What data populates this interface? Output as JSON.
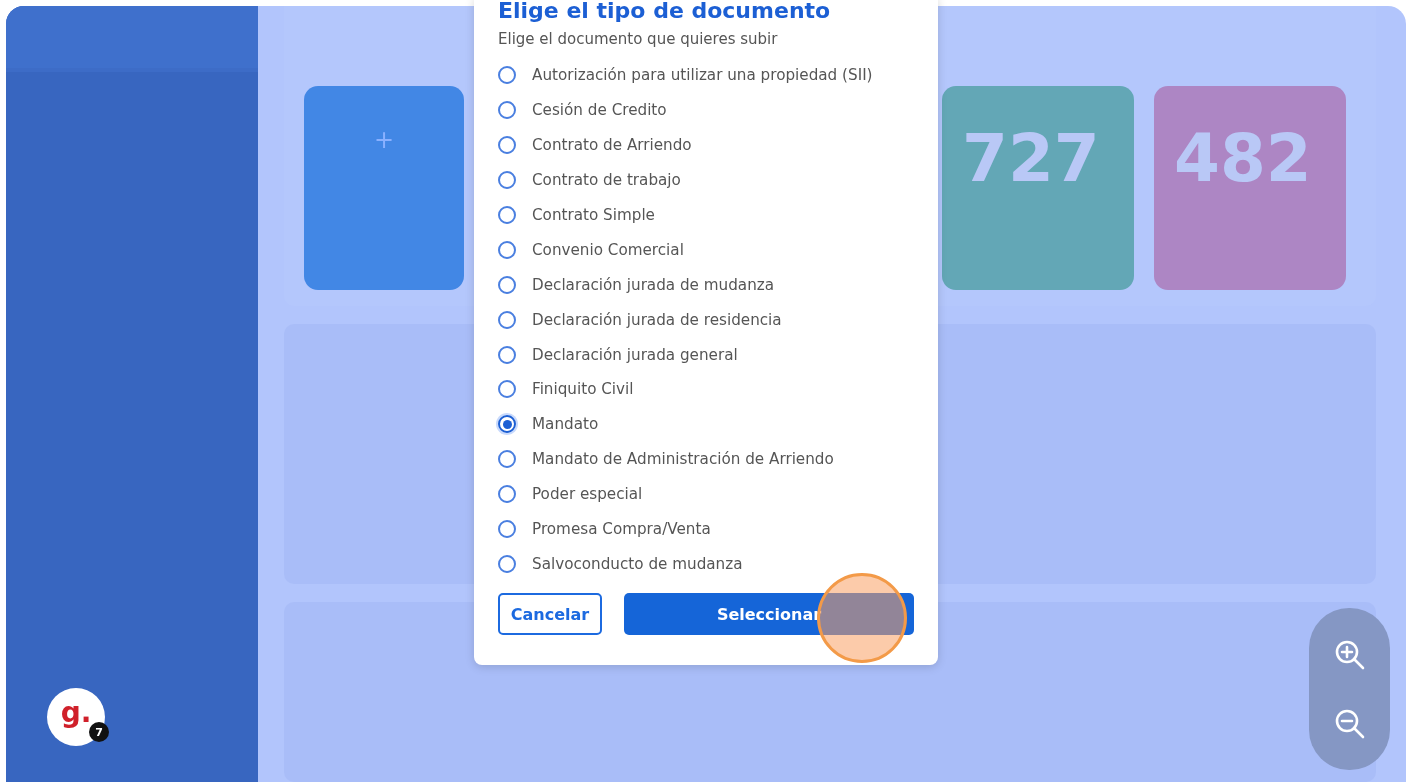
{
  "background": {
    "create_card": {
      "symbol": "+"
    },
    "stats": [
      {
        "value": "727",
        "color": "#63a7b6"
      },
      {
        "value": "482",
        "color": "#ad86c4"
      }
    ]
  },
  "dialog": {
    "title": "Elige el tipo de documento",
    "subtitle": "Elige el documento que quieres subir",
    "options": [
      {
        "label": "Autorización para utilizar una propiedad (SII)",
        "selected": false
      },
      {
        "label": "Cesión de Credito",
        "selected": false
      },
      {
        "label": "Contrato de Arriendo",
        "selected": false
      },
      {
        "label": "Contrato de trabajo",
        "selected": false
      },
      {
        "label": "Contrato Simple",
        "selected": false
      },
      {
        "label": "Convenio Comercial",
        "selected": false
      },
      {
        "label": "Declaración jurada de mudanza",
        "selected": false
      },
      {
        "label": "Declaración jurada de residencia",
        "selected": false
      },
      {
        "label": "Declaración jurada general",
        "selected": false
      },
      {
        "label": "Finiquito Civil",
        "selected": false
      },
      {
        "label": "Mandato",
        "selected": true
      },
      {
        "label": "Mandato de Administración de Arriendo",
        "selected": false
      },
      {
        "label": "Poder especial",
        "selected": false
      },
      {
        "label": "Promesa Compra/Venta",
        "selected": false
      },
      {
        "label": "Salvoconducto de mudanza",
        "selected": false
      }
    ],
    "buttons": [
      {
        "label": "Cancelar",
        "kind": "secondary"
      },
      {
        "label": "Seleccionar",
        "kind": "primary"
      }
    ]
  },
  "logo": {
    "letter": "g.",
    "badge": "7"
  }
}
